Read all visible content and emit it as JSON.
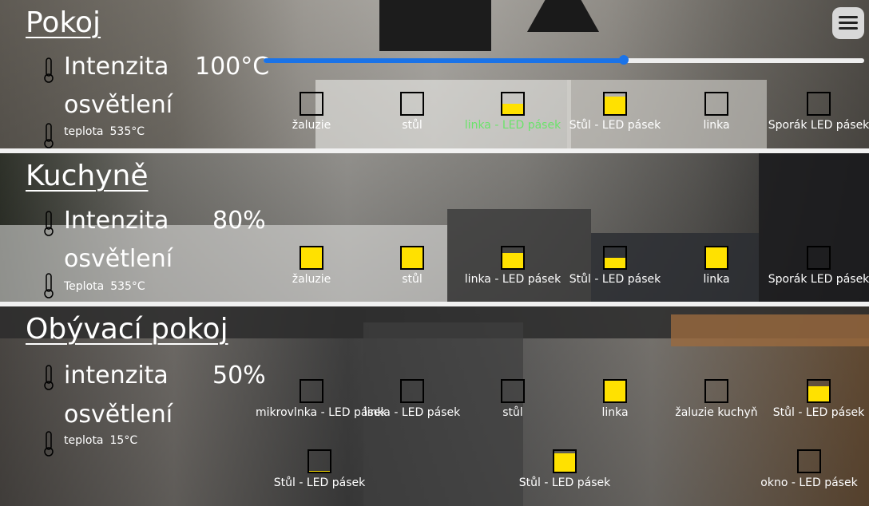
{
  "menu": {
    "icon": "hamburger-menu-icon"
  },
  "rooms": [
    {
      "name": "Pokoj",
      "intensity_label_1": "Intenzita",
      "intensity_label_2": "osvětlení",
      "intensity_value": "100°C",
      "slider_value_percent": 60,
      "temp_label": "teplota",
      "temp_value": "535°C",
      "devices": [
        {
          "label": "žaluzie",
          "level": 0
        },
        {
          "label": "stůl",
          "level": 0
        },
        {
          "label": "linka - LED pásek",
          "level": 0.5,
          "highlight": true
        },
        {
          "label": "Stůl - LED pásek",
          "level": 0.85
        },
        {
          "label": "linka",
          "level": 0
        },
        {
          "label": "Sporák LED pásek",
          "level": 0
        }
      ]
    },
    {
      "name": "Kuchyně",
      "intensity_label_1": "Intenzita",
      "intensity_label_2": "osvětlení",
      "intensity_value": "80%",
      "temp_label": "Teplota",
      "temp_value": "535°C",
      "devices": [
        {
          "label": "žaluzie",
          "level": 1
        },
        {
          "label": "stůl",
          "level": 1
        },
        {
          "label": "linka - LED pásek",
          "level": 0.75
        },
        {
          "label": "Stůl - LED pásek",
          "level": 0.5
        },
        {
          "label": "linka",
          "level": 1
        },
        {
          "label": "Sporák LED pásek",
          "level": 0
        }
      ]
    },
    {
      "name": "Obývací pokoj",
      "intensity_label_1": "intenzita",
      "intensity_label_2": "osvětlení",
      "intensity_value": "50%",
      "temp_label": "teplota",
      "temp_value": "15°C",
      "devices_row1": [
        {
          "label": "mikrovlnka - LED pásek",
          "level": 0
        },
        {
          "label": "linka - LED pásek",
          "level": 0
        },
        {
          "label": "stůl",
          "level": 0
        },
        {
          "label": "linka",
          "level": 1
        },
        {
          "label": "žaluzie kuchyň",
          "level": 0
        },
        {
          "label": "Stůl - LED pásek",
          "level": 0.75
        }
      ],
      "devices_row2": [
        {
          "label": "Stůl - LED pásek",
          "level": 0.05
        },
        {
          "label": "Stůl - LED pásek",
          "level": 0.9
        },
        {
          "label": "okno - LED pásek",
          "level": 0
        }
      ]
    }
  ],
  "colors": {
    "fill": "#ffe100",
    "slider": "#1a73e8",
    "highlight_text": "#6be36b"
  }
}
